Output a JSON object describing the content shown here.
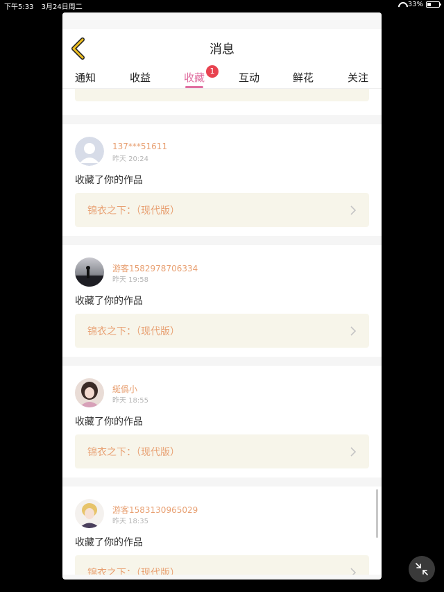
{
  "status_bar": {
    "time": "下午5:33",
    "date": "3月24日周二",
    "battery_percent_label": "33%",
    "battery_level": 0.33
  },
  "header": {
    "title": "消息",
    "back_icon": "chevron-left-icon"
  },
  "tabs": [
    {
      "label": "通知",
      "active": false
    },
    {
      "label": "收益",
      "active": false
    },
    {
      "label": "收藏",
      "active": true,
      "badge": "1"
    },
    {
      "label": "互动",
      "active": false
    },
    {
      "label": "鲜花",
      "active": false
    },
    {
      "label": "关注",
      "active": false
    }
  ],
  "items": [
    {
      "user": "137***51611",
      "time": "昨天 20:24",
      "action": "收藏了你的作品",
      "work": "锦衣之下：（现代版）",
      "avatar": "default-avatar"
    },
    {
      "user": "游客1582978706334",
      "time": "昨天 19:58",
      "action": "收藏了你的作品",
      "work": "锦衣之下：（现代版）",
      "avatar": "photo-avatar-silhouette"
    },
    {
      "user": "綖僞小",
      "time": "昨天 18:55",
      "action": "收藏了你的作品",
      "work": "锦衣之下：（现代版）",
      "avatar": "photo-avatar-girl"
    },
    {
      "user": "游客1583130965029",
      "time": "昨天 18:35",
      "action": "收藏了你的作品",
      "work": "锦衣之下：（现代版）",
      "avatar": "photo-avatar-boy"
    }
  ],
  "colors": {
    "accent_pink": "#e06fa0",
    "badge_red": "#e84350",
    "username_orange": "#e8a072",
    "card_beige": "#f7f5ea",
    "back_yellow": "#f0c020"
  },
  "floating_button_icon": "collapse-arrows-icon"
}
